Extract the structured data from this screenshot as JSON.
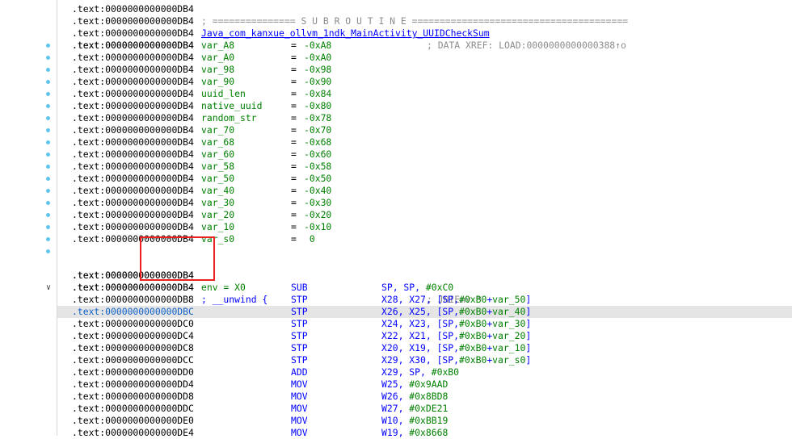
{
  "colors": {
    "address": "#000000",
    "name_green": "#008000",
    "mnemonic_blue": "#0000ff",
    "comment_gray": "#8c8c8c",
    "highlight_row": "#e5e5e5",
    "annotation_red": "#e8211e",
    "gutter_dot": "#5ec6ee"
  },
  "header_rows": [
    {
      "addr": ".text:0000000000000DB4",
      "tail": "; =============== S U B R O U T I N E ======================================="
    },
    {
      "addr": ".text:0000000000000DB4",
      "fname": "Java_com_kanxue_ollvm_1ndk_MainActivity_UUIDCheckSum"
    },
    {
      "addr": ".text:0000000000000DB4",
      "comment": "; DATA XREF: LOAD:0000000000000388↑o"
    },
    {
      "addr": ".text:0000000000000DB4"
    }
  ],
  "var_rows": [
    {
      "addr": ".text:0000000000000DB4",
      "name": "var_A8",
      "eq": "=",
      "val": "-0xA8"
    },
    {
      "addr": ".text:0000000000000DB4",
      "name": "var_A0",
      "eq": "=",
      "val": "-0xA0"
    },
    {
      "addr": ".text:0000000000000DB4",
      "name": "var_98",
      "eq": "=",
      "val": "-0x98"
    },
    {
      "addr": ".text:0000000000000DB4",
      "name": "var_90",
      "eq": "=",
      "val": "-0x90"
    },
    {
      "addr": ".text:0000000000000DB4",
      "name": "uuid_len",
      "eq": "=",
      "val": "-0x84"
    },
    {
      "addr": ".text:0000000000000DB4",
      "name": "native_uuid",
      "eq": "=",
      "val": "-0x80"
    },
    {
      "addr": ".text:0000000000000DB4",
      "name": "random_str",
      "eq": "=",
      "val": "-0x78"
    },
    {
      "addr": ".text:0000000000000DB4",
      "name": "var_70",
      "eq": "=",
      "val": "-0x70"
    },
    {
      "addr": ".text:0000000000000DB4",
      "name": "var_68",
      "eq": "=",
      "val": "-0x68"
    },
    {
      "addr": ".text:0000000000000DB4",
      "name": "var_60",
      "eq": "=",
      "val": "-0x60"
    },
    {
      "addr": ".text:0000000000000DB4",
      "name": "var_58",
      "eq": "=",
      "val": "-0x58"
    },
    {
      "addr": ".text:0000000000000DB4",
      "name": "var_50",
      "eq": "=",
      "val": "-0x50"
    },
    {
      "addr": ".text:0000000000000DB4",
      "name": "var_40",
      "eq": "=",
      "val": "-0x40"
    },
    {
      "addr": ".text:0000000000000DB4",
      "name": "var_30",
      "eq": "=",
      "val": "-0x30"
    },
    {
      "addr": ".text:0000000000000DB4",
      "name": "var_20",
      "eq": "=",
      "val": "-0x20"
    },
    {
      "addr": ".text:0000000000000DB4",
      "name": "var_10",
      "eq": "=",
      "val": "-0x10"
    },
    {
      "addr": ".text:0000000000000DB4",
      "name": "var_s0",
      "eq": "=",
      "val": " 0"
    }
  ],
  "post_var_rows": [
    {
      "addr": ".text:0000000000000DB4"
    },
    {
      "addr": ".text:0000000000000DB4",
      "name": "env = X0",
      "comment": "; JNIEnv *"
    },
    {
      "addr": ".text:0000000000000DB4",
      "name": "; __unwind {"
    }
  ],
  "instr_rows": [
    {
      "addr": ".text:0000000000000DB4",
      "mnem": "SUB",
      "ops": "SP, SP, #0xC0",
      "chev": true
    },
    {
      "addr": ".text:0000000000000DB8",
      "mnem": "STP",
      "ops": "X28, X27, [SP,#0xB0+var_50]"
    },
    {
      "addr": ".text:0000000000000DBC",
      "mnem": "STP",
      "ops": "X26, X25, [SP,#0xB0+var_40]",
      "highlight": true
    },
    {
      "addr": ".text:0000000000000DC0",
      "mnem": "STP",
      "ops": "X24, X23, [SP,#0xB0+var_30]"
    },
    {
      "addr": ".text:0000000000000DC4",
      "mnem": "STP",
      "ops": "X22, X21, [SP,#0xB0+var_20]"
    },
    {
      "addr": ".text:0000000000000DC8",
      "mnem": "STP",
      "ops": "X20, X19, [SP,#0xB0+var_10]"
    },
    {
      "addr": ".text:0000000000000DCC",
      "mnem": "STP",
      "ops": "X29, X30, [SP,#0xB0+var_s0]"
    },
    {
      "addr": ".text:0000000000000DD0",
      "mnem": "ADD",
      "ops": "X29, SP, #0xB0"
    },
    {
      "addr": ".text:0000000000000DD4",
      "mnem": "MOV",
      "ops": "W25, #0x9AAD"
    },
    {
      "addr": ".text:0000000000000DD8",
      "mnem": "MOV",
      "ops": "W26, #0x8BD8"
    },
    {
      "addr": ".text:0000000000000DDC",
      "mnem": "MOV",
      "ops": "W27, #0xDE21"
    },
    {
      "addr": ".text:0000000000000DE0",
      "mnem": "MOV",
      "ops": "W10, #0xBB19"
    },
    {
      "addr": ".text:0000000000000DE4",
      "mnem": "MOV",
      "ops": "W19, #0x8668"
    }
  ]
}
